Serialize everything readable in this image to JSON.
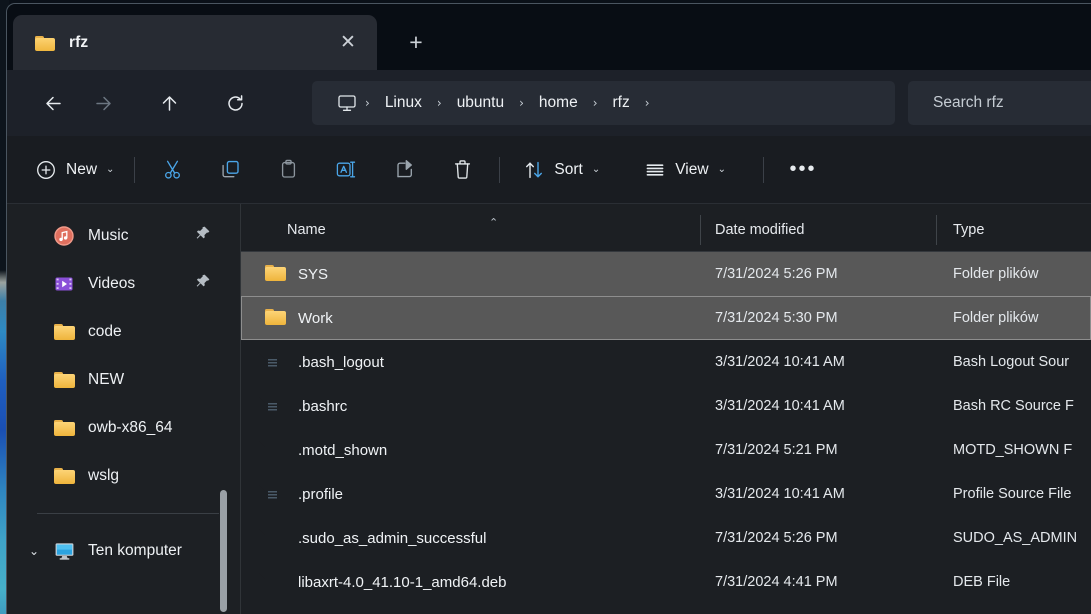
{
  "window": {
    "tab": {
      "title": "rfz",
      "folder_icon": "folder-icon",
      "close_icon": "close-icon"
    },
    "new_tab_icon": "plus-icon"
  },
  "nav": {
    "back_icon": "arrow-left-icon",
    "forward_icon": "arrow-right-icon",
    "up_icon": "arrow-up-icon",
    "refresh_icon": "refresh-icon",
    "breadcrumb": {
      "root_icon": "monitor-icon",
      "separator": "›",
      "crumbs": [
        "Linux",
        "ubuntu",
        "home",
        "rfz"
      ]
    },
    "search": {
      "placeholder": "Search rfz"
    }
  },
  "toolbar": {
    "new_label": "New",
    "new_icon": "plus-circle-icon",
    "chevron": "⌄",
    "cut_icon": "scissors-icon",
    "copy_icon": "copy-icon",
    "paste_icon": "clipboard-icon",
    "rename_icon": "rename-icon",
    "share_icon": "share-icon",
    "delete_icon": "trash-icon",
    "sort_label": "Sort",
    "sort_icon": "sort-arrows-icon",
    "view_label": "View",
    "view_icon": "list-view-icon",
    "overflow_label": "•••"
  },
  "sidebar": {
    "items": [
      {
        "label": "Music",
        "icon": "music-icon",
        "pinned": true,
        "expandable": false
      },
      {
        "label": "Videos",
        "icon": "video-icon",
        "pinned": true,
        "expandable": false
      },
      {
        "label": "code",
        "icon": "folder-icon",
        "pinned": false,
        "expandable": false
      },
      {
        "label": "NEW",
        "icon": "folder-icon",
        "pinned": false,
        "expandable": false
      },
      {
        "label": "owb-x86_64",
        "icon": "folder-icon",
        "pinned": false,
        "expandable": false
      },
      {
        "label": "wslg",
        "icon": "folder-icon",
        "pinned": false,
        "expandable": false
      }
    ],
    "computer": {
      "label": "Ten komputer",
      "icon": "monitor-icon",
      "expanded": true,
      "chevron": "⌄"
    }
  },
  "filelist": {
    "columns": {
      "name": "Name",
      "date": "Date modified",
      "type": "Type"
    },
    "sort_indicator": "⌃",
    "rows": [
      {
        "name": "SYS",
        "date": "7/31/2024 5:26 PM",
        "type": "Folder plików",
        "icon": "folder-icon",
        "selected": true,
        "focused": false
      },
      {
        "name": "Work",
        "date": "7/31/2024 5:30 PM",
        "type": "Folder plików",
        "icon": "folder-icon",
        "selected": true,
        "focused": true
      },
      {
        "name": ".bash_logout",
        "date": "3/31/2024 10:41 AM",
        "type": "Bash Logout Sour",
        "icon": "text-file-icon",
        "selected": false,
        "focused": false
      },
      {
        "name": ".bashrc",
        "date": "3/31/2024 10:41 AM",
        "type": "Bash RC Source F",
        "icon": "text-file-icon",
        "selected": false,
        "focused": false
      },
      {
        "name": ".motd_shown",
        "date": "7/31/2024 5:21 PM",
        "type": "MOTD_SHOWN F",
        "icon": "blank-file-icon",
        "selected": false,
        "focused": false
      },
      {
        "name": ".profile",
        "date": "3/31/2024 10:41 AM",
        "type": "Profile Source File",
        "icon": "text-file-icon",
        "selected": false,
        "focused": false
      },
      {
        "name": ".sudo_as_admin_successful",
        "date": "7/31/2024 5:26 PM",
        "type": "SUDO_AS_ADMIN",
        "icon": "blank-file-icon",
        "selected": false,
        "focused": false
      },
      {
        "name": "libaxrt-4.0_41.10-1_amd64.deb",
        "date": "7/31/2024 4:41 PM",
        "type": "DEB File",
        "icon": "blank-file-icon",
        "selected": false,
        "focused": false
      }
    ]
  },
  "colors": {
    "window_bg": "#1d2129",
    "tabstrip_bg": "#080d14",
    "toolbar_bg": "#191c21",
    "sidebar_bg": "#1d2024",
    "filepane_bg": "#1c1f23",
    "selection": "#585858",
    "accent_blue": "#4aa5e8",
    "folder_yellow": "#f0b73f"
  }
}
